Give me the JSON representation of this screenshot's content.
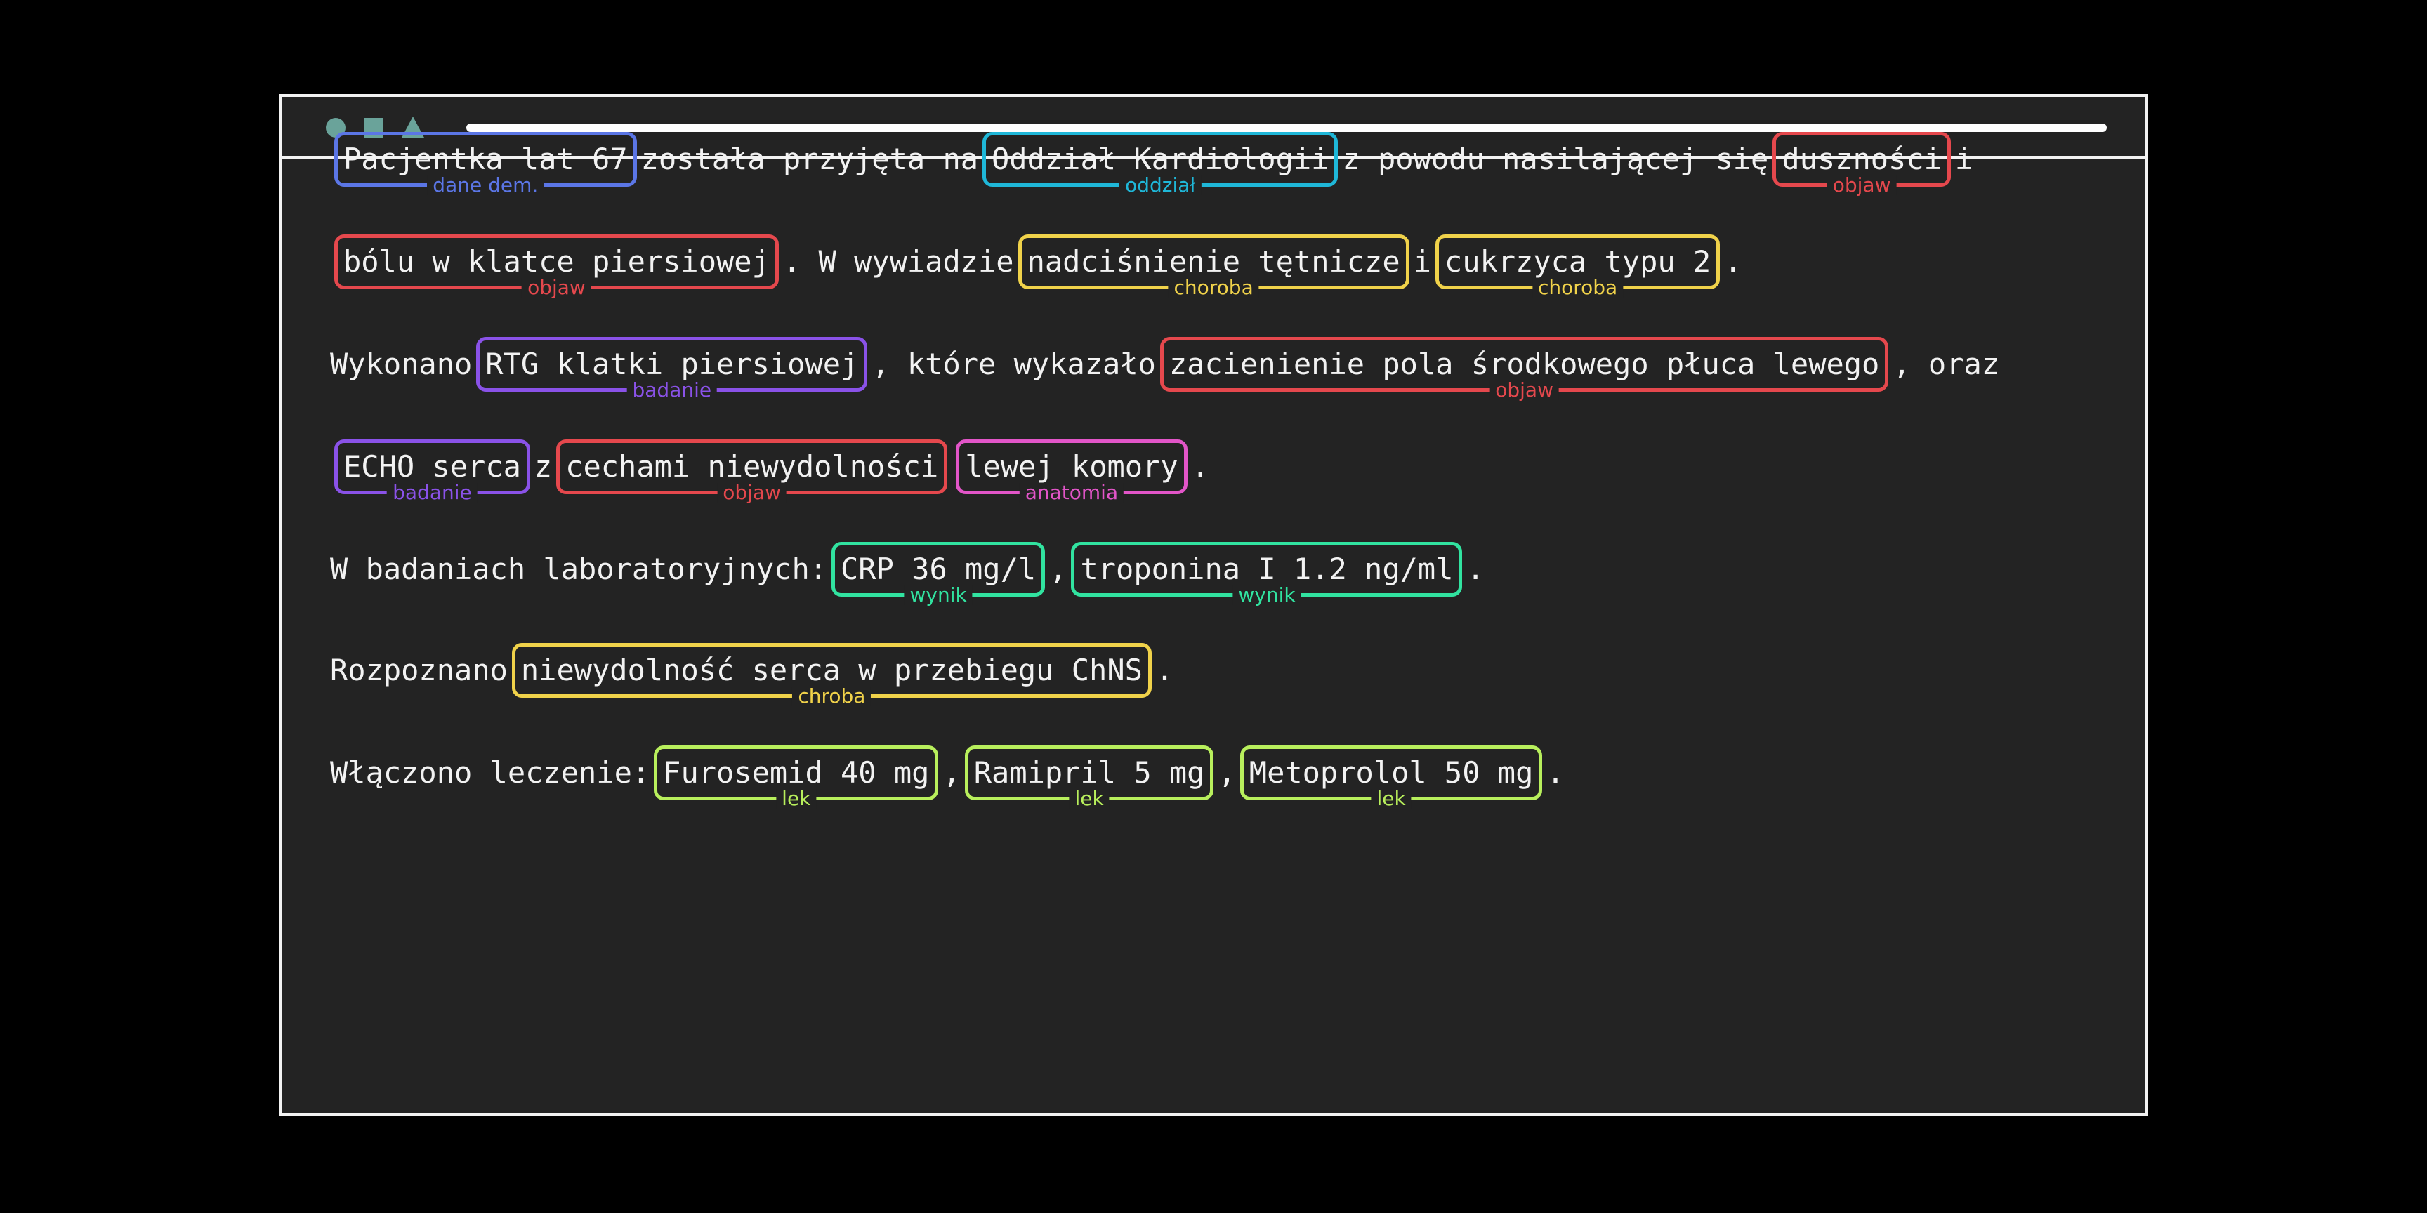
{
  "window": {
    "controls": [
      {
        "name": "circle-icon",
        "color": "#6aa39a"
      },
      {
        "name": "square-icon",
        "color": "#6aa39a"
      },
      {
        "name": "triangle-icon",
        "color": "#6aa39a"
      }
    ],
    "address_bar_color": "#ffffff"
  },
  "colors": {
    "dane dem.": "#5b76e6",
    "oddział": "#1fb7d8",
    "objaw": "#e5484d",
    "choroba": "#f0d24a",
    "badanie": "#8a52e8",
    "anatomia": "#e255c8",
    "wynik": "#31e3a0",
    "lek": "#b8ef5c"
  },
  "lines": [
    [
      {
        "entity": "Pacjentka lat 67",
        "label": "dane dem."
      },
      {
        "text": "została przyjęta na"
      },
      {
        "entity": "Oddział Kardiologii",
        "label": "oddział"
      },
      {
        "text": "z powodu nasilającej się"
      },
      {
        "entity": "duszności",
        "label": "objaw"
      },
      {
        "text": "i"
      }
    ],
    [
      {
        "entity": "bólu w klatce piersiowej",
        "label": "objaw"
      },
      {
        "text": ". W wywiadzie"
      },
      {
        "entity": "nadciśnienie tętnicze",
        "label": "choroba"
      },
      {
        "text": "i"
      },
      {
        "entity": "cukrzyca typu 2",
        "label": "choroba"
      },
      {
        "text": "."
      }
    ],
    [
      {
        "text": "Wykonano"
      },
      {
        "entity": "RTG klatki piersiowej",
        "label": "badanie"
      },
      {
        "text": ", które wykazało"
      },
      {
        "entity": "zacienienie pola środkowego płuca lewego",
        "label": "objaw"
      },
      {
        "text": ", oraz"
      }
    ],
    [
      {
        "entity": "ECHO serca",
        "label": "badanie"
      },
      {
        "text": "z"
      },
      {
        "entity": "cechami niewydolności",
        "label": "objaw"
      },
      {
        "entity": "lewej komory",
        "label": "anatomia"
      },
      {
        "text": "."
      }
    ],
    [
      {
        "text": "W badaniach laboratoryjnych:"
      },
      {
        "entity": "CRP 36 mg/l",
        "label": "wynik"
      },
      {
        "text": ","
      },
      {
        "entity": "troponina I 1.2 ng/ml",
        "label": "wynik"
      },
      {
        "text": "."
      }
    ],
    [
      {
        "text": "Rozpoznano"
      },
      {
        "entity": "niewydolność serca w przebiegu ChNS",
        "label": "chroba"
      },
      {
        "text": "."
      }
    ],
    [
      {
        "text": "Włączono leczenie:"
      },
      {
        "entity": "Furosemid 40 mg",
        "label": "lek"
      },
      {
        "text": ","
      },
      {
        "entity": "Ramipril 5 mg",
        "label": "lek"
      },
      {
        "text": ","
      },
      {
        "entity": "Metoprolol 50 mg",
        "label": "lek"
      },
      {
        "text": "."
      }
    ]
  ]
}
